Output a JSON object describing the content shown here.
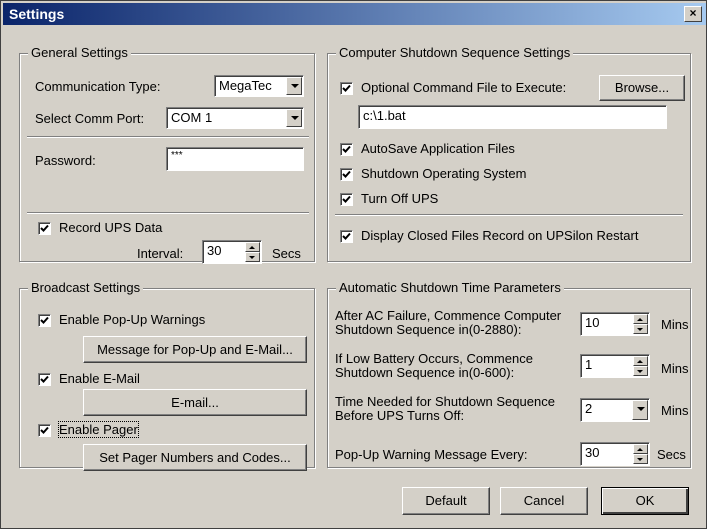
{
  "window": {
    "title": "Settings",
    "close_label": "×"
  },
  "general": {
    "legend": "General Settings",
    "comm_type_label": "Communication Type:",
    "comm_type_value": "MegaTec",
    "comm_port_label": "Select Comm Port:",
    "comm_port_value": "COM 1",
    "password_label": "Password:",
    "password_value": "***",
    "record_label": "Record UPS Data",
    "record_checked": true,
    "interval_label": "Interval:",
    "interval_value": "30",
    "interval_unit": "Secs"
  },
  "shutdown": {
    "legend": "Computer Shutdown Sequence Settings",
    "optional_cmd_label": "Optional Command File to Execute:",
    "optional_cmd_checked": true,
    "browse_label": "Browse...",
    "cmd_path": "c:\\1.bat",
    "autosave_label": "AutoSave Application Files",
    "autosave_checked": true,
    "shutdown_os_label": "Shutdown Operating System",
    "shutdown_os_checked": true,
    "turn_off_label": "Turn Off UPS",
    "turn_off_checked": true,
    "display_closed_label": "Display Closed Files Record on UPSilon Restart",
    "display_closed_checked": true
  },
  "broadcast": {
    "legend": "Broadcast Settings",
    "popup_label": "Enable Pop-Up Warnings",
    "popup_checked": true,
    "popup_msg_button": "Message for Pop-Up and E-Mail...",
    "email_label": "Enable E-Mail",
    "email_checked": true,
    "email_button": "E-mail...",
    "pager_label": "Enable Pager",
    "pager_checked": true,
    "pager_button": "Set Pager Numbers and Codes..."
  },
  "auto": {
    "legend": "Automatic Shutdown Time Parameters",
    "ac_fail_line1": "After AC Failure, Commence Computer",
    "ac_fail_line2": "Shutdown Sequence in(0-2880):",
    "ac_fail_value": "10",
    "ac_fail_unit": "Mins",
    "low_batt_line1": "If Low Battery Occurs, Commence",
    "low_batt_line2": "Shutdown Sequence in(0-600):",
    "low_batt_value": "1",
    "low_batt_unit": "Mins",
    "time_needed_line1": "Time Needed for Shutdown Sequence",
    "time_needed_line2": "Before UPS Turns Off:",
    "time_needed_value": "2",
    "time_needed_unit": "Mins",
    "popup_every_label": "Pop-Up Warning Message Every:",
    "popup_every_value": "30",
    "popup_every_unit": "Secs"
  },
  "footer": {
    "default_label": "Default",
    "cancel_label": "Cancel",
    "ok_label": "OK"
  }
}
